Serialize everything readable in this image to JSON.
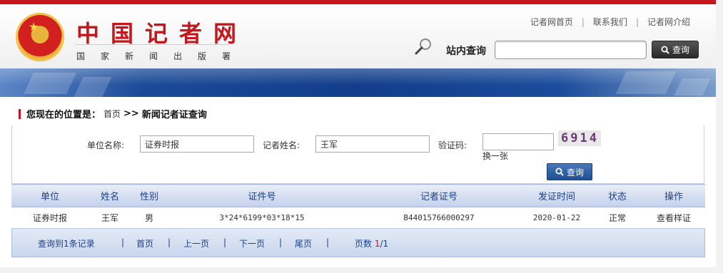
{
  "header": {
    "site_title": "中国记者网",
    "site_subtitle": "国家新闻出版署",
    "links": [
      "记者网首页",
      "联系我们",
      "记者网介绍"
    ],
    "link_separator": "|",
    "search_label": "站内查询",
    "search_value": "",
    "search_button": "查询"
  },
  "breadcrumb": {
    "prefix": "您现在的位置是：",
    "home": "首页",
    "arrow": ">>",
    "current": "新闻记者证查询"
  },
  "form": {
    "unit_label": "单位名称:",
    "unit_value": "证券时报",
    "name_label": "记者姓名:",
    "name_value": "王军",
    "captcha_label": "验证码:",
    "captcha_value": "",
    "captcha_text": "6914",
    "refresh_label": "换一张",
    "query_button": "查询"
  },
  "table": {
    "headers": [
      "单位",
      "姓名",
      "性别",
      "证件号",
      "记者证号",
      "发证时间",
      "状态",
      "操作"
    ],
    "rows": [
      [
        "证券时报",
        "王军",
        "男",
        "3*24*6199*03*18*15",
        "B44015766000297",
        "2020-01-22",
        "正常",
        "查看样证"
      ]
    ]
  },
  "pager": {
    "summary": "查询到1条记录",
    "first": "首页",
    "prev": "上一页",
    "next": "下一页",
    "last": "尾页",
    "sep": "|",
    "pages_label": "页数",
    "current_page": "1",
    "page_total": "/1"
  },
  "colors": {
    "brand_red": "#c4161c",
    "nav_blue": "#1d3f86",
    "banner_blue": "#123d8a"
  },
  "icons": {
    "magnifier": "magnifier-icon",
    "search_btn": "search-icon",
    "emblem": "national-emblem"
  }
}
